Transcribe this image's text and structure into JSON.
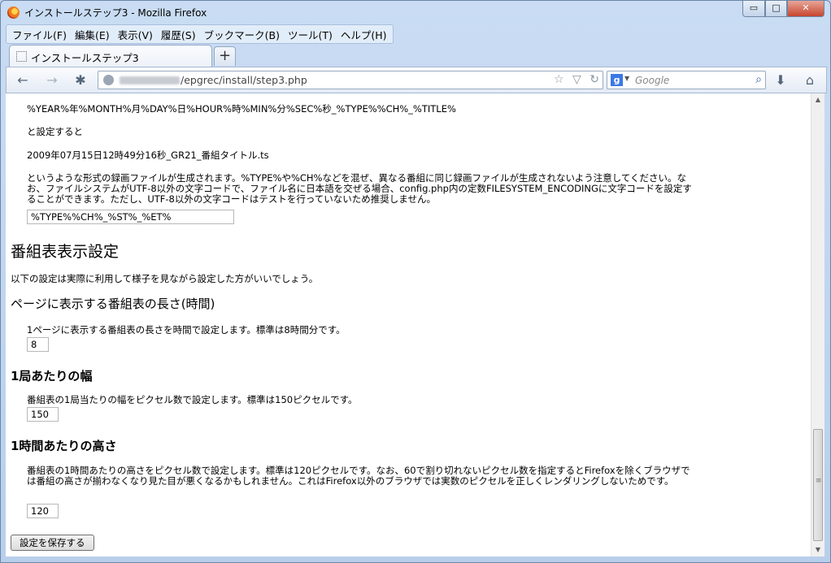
{
  "window": {
    "title": "インストールステップ3 - Mozilla Firefox",
    "controls": {
      "minimize": "▭",
      "maximize": "□",
      "close": "✕"
    }
  },
  "menu": [
    "ファイル(F)",
    "編集(E)",
    "表示(V)",
    "履歴(S)",
    "ブックマーク(B)",
    "ツール(T)",
    "ヘルプ(H)"
  ],
  "tab": {
    "label": "インストールステップ3",
    "new_tab": "+"
  },
  "nav": {
    "back": "←",
    "forward": "→",
    "addon": "✱",
    "url_path": "/epgrec/install/step3.php",
    "url_icons": {
      "star": "☆",
      "drop": "▽",
      "reload": "↻"
    },
    "search_engine": "g",
    "search_drop": "▼",
    "search_placeholder": "Google",
    "search_mag": "⌕",
    "download": "⬇",
    "home": "⌂"
  },
  "content": {
    "format_example": "%YEAR%年%MONTH%月%DAY%日%HOUR%時%MIN%分%SEC%秒_%TYPE%%CH%_%TITLE%",
    "if_set": "と設定すると",
    "filename_example": "2009年07月15日12時49分16秒_GR21_番組タイトル.ts",
    "filename_note": "というような形式の録画ファイルが生成されます。%TYPE%や%CH%などを混ぜ、異なる番組に同じ録画ファイルが生成されないよう注意してください。なお、ファイルシステムがUTF-8以外の文字コードで、ファイル名に日本語を交ぜる場合、config.php内の定数FILESYSTEM_ENCODINGに文字コードを設定することができます。ただし、UTF-8以外の文字コードはテストを行っていないため推奨しません。",
    "filename_format_value": "%TYPE%%CH%_%ST%_%ET%",
    "program_table_heading": "番組表表示設定",
    "program_table_intro": "以下の設定は実際に利用して様子を見ながら設定した方がいいでしょう。",
    "length_heading": "ページに表示する番組表の長さ(時間)",
    "length_desc": "1ページに表示する番組表の長さを時間で設定します。標準は8時間分です。",
    "length_value": "8",
    "width_heading": "1局あたりの幅",
    "width_desc": "番組表の1局当たりの幅をピクセル数で設定します。標準は150ピクセルです。",
    "width_value": "150",
    "height_heading": "1時間あたりの高さ",
    "height_desc": "番組表の1時間あたりの高さをピクセル数で設定します。標準は120ピクセルです。なお、60で割り切れないピクセル数を指定するとFirefoxを除くブラウザでは番組の高さが揃わなくなり見た目が悪くなるかもしれません。これはFirefox以外のブラウザでは実数のピクセルを正しくレンダリングしないためです。",
    "height_value": "120",
    "save_button": "設定を保存する"
  },
  "scrollbar": {
    "up": "▲",
    "down": "▼",
    "grip": "≡"
  }
}
